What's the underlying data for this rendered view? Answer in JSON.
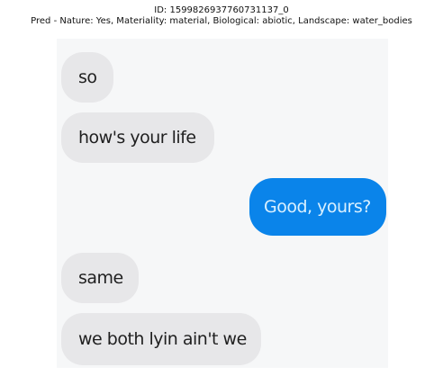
{
  "header": {
    "id_line": "ID: 1599826937760731137_0",
    "pred_line": "Pred - Nature: Yes, Materiality: material, Biological: abiotic, Landscape: water_bodies"
  },
  "conversation": {
    "messages": [
      {
        "text": "so",
        "direction": "incoming"
      },
      {
        "text": "how's your life",
        "direction": "incoming"
      },
      {
        "text": "Good, yours?",
        "direction": "outgoing"
      },
      {
        "text": "same",
        "direction": "incoming"
      },
      {
        "text": "we both lyin ain't we",
        "direction": "incoming"
      }
    ]
  },
  "colors": {
    "incoming_bubble": "#e7e7e9",
    "outgoing_bubble": "#0a84ea",
    "outgoing_text": "#d9f0ff"
  }
}
